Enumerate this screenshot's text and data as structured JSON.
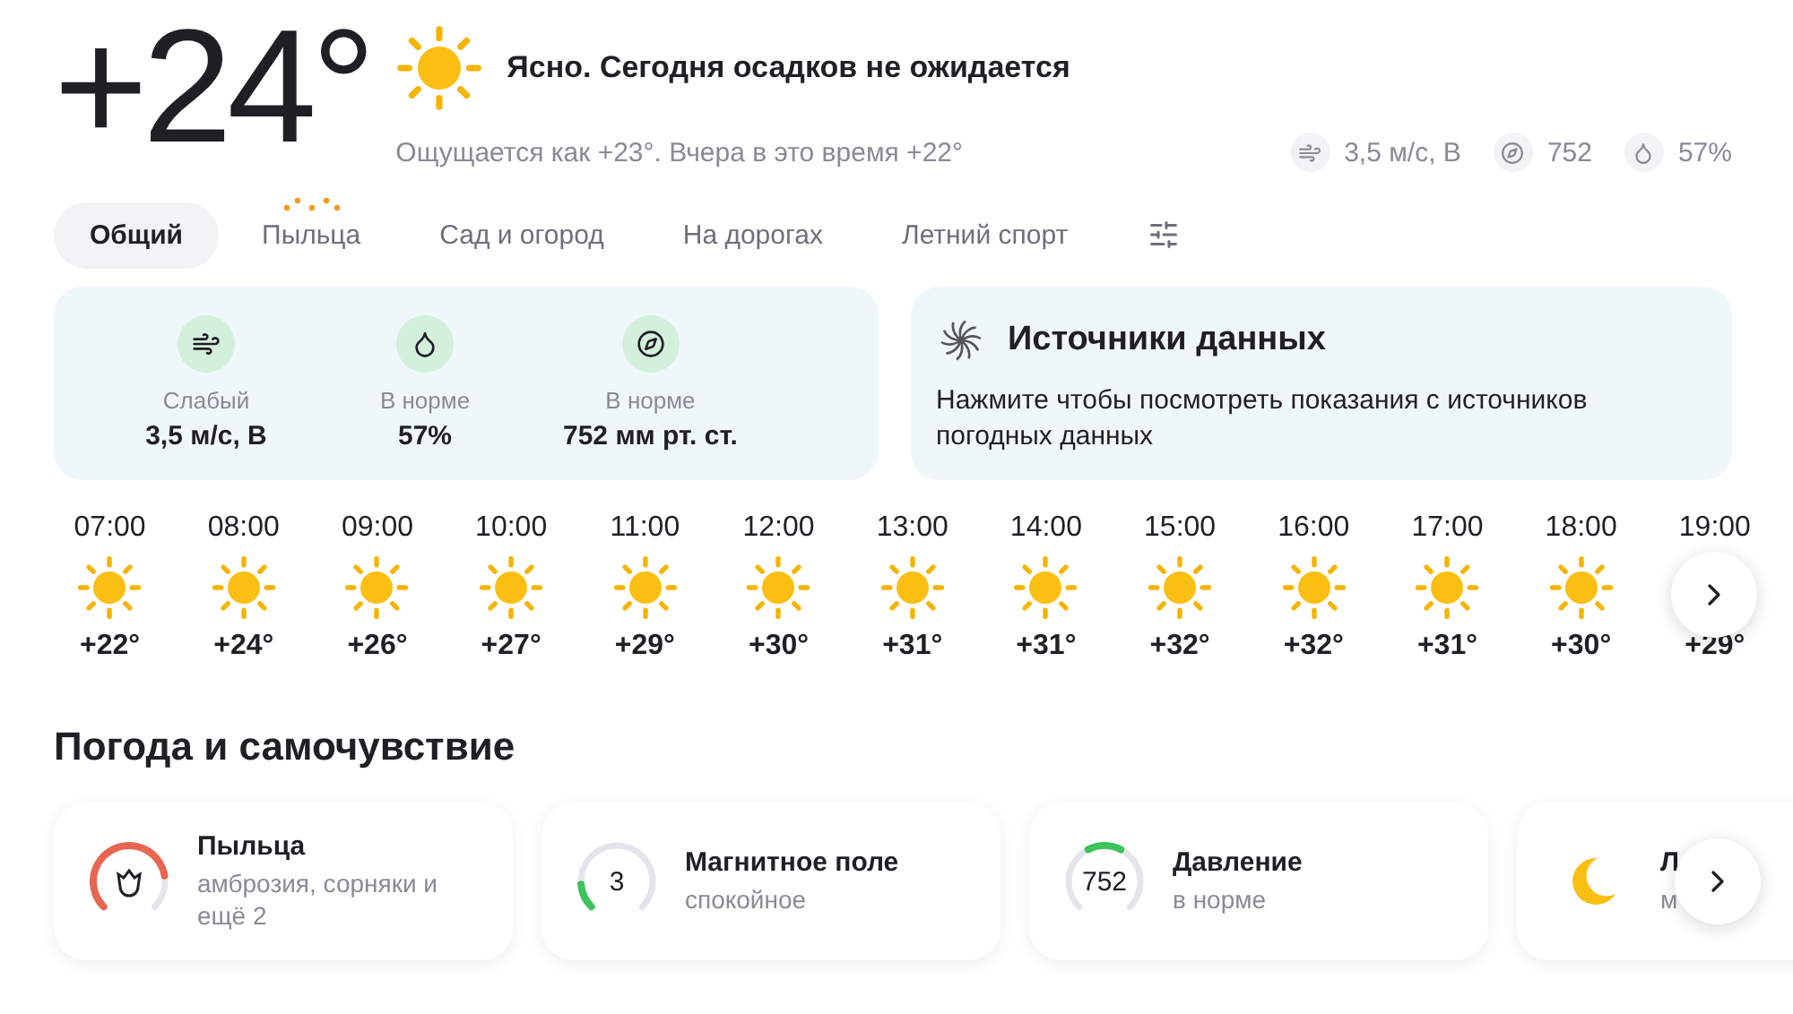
{
  "current": {
    "temperature": "+24°",
    "condition": "Ясно. Сегодня осадков не ожидается",
    "feels": "Ощущается как +23°. Вчера в это время +22°",
    "metrics": [
      {
        "kind": "wind",
        "value": "3,5 м/с, В"
      },
      {
        "kind": "pressure",
        "value": "752"
      },
      {
        "kind": "humidity",
        "value": "57%"
      }
    ]
  },
  "tabs": [
    {
      "label": "Общий",
      "selected": true,
      "alert": false
    },
    {
      "label": "Пыльца",
      "selected": false,
      "alert": true
    },
    {
      "label": "Сад и огород",
      "selected": false,
      "alert": false
    },
    {
      "label": "На дорогах",
      "selected": false,
      "alert": false
    },
    {
      "label": "Летний спорт",
      "selected": false,
      "alert": false
    }
  ],
  "details": [
    {
      "kind": "wind",
      "status": "Слабый",
      "value": "3,5 м/с, В"
    },
    {
      "kind": "humidity",
      "status": "В норме",
      "value": "57%"
    },
    {
      "kind": "pressure",
      "status": "В норме",
      "value": "752 мм рт. ст."
    }
  ],
  "sources": {
    "title": "Источники данных",
    "text": "Нажмите чтобы посмотреть показания с источников погодных данных"
  },
  "hourly": [
    {
      "time": "07:00",
      "temp": "+22°"
    },
    {
      "time": "08:00",
      "temp": "+24°"
    },
    {
      "time": "09:00",
      "temp": "+26°"
    },
    {
      "time": "10:00",
      "temp": "+27°"
    },
    {
      "time": "11:00",
      "temp": "+29°"
    },
    {
      "time": "12:00",
      "temp": "+30°"
    },
    {
      "time": "13:00",
      "temp": "+31°"
    },
    {
      "time": "14:00",
      "temp": "+31°"
    },
    {
      "time": "15:00",
      "temp": "+32°"
    },
    {
      "time": "16:00",
      "temp": "+32°"
    },
    {
      "time": "17:00",
      "temp": "+31°"
    },
    {
      "time": "18:00",
      "temp": "+30°"
    },
    {
      "time": "19:00",
      "temp": "+29°"
    }
  ],
  "wellbeing": {
    "title": "Погода и самочувствие",
    "cards": [
      {
        "kind": "pollen",
        "title": "Пыльца",
        "subtitle": "амброзия, сорняки и ещё 2",
        "level": 0.8,
        "color": "#e8654f"
      },
      {
        "kind": "magnetic",
        "title": "Магнитное поле",
        "subtitle": "спокойное",
        "value": "3",
        "level": 0.15,
        "color": "#3cc35b"
      },
      {
        "kind": "pressure",
        "title": "Давление",
        "subtitle": "в норме",
        "value": "752",
        "color": "#3cc35b"
      },
      {
        "kind": "moon",
        "title": "Л",
        "subtitle": "м"
      }
    ]
  }
}
